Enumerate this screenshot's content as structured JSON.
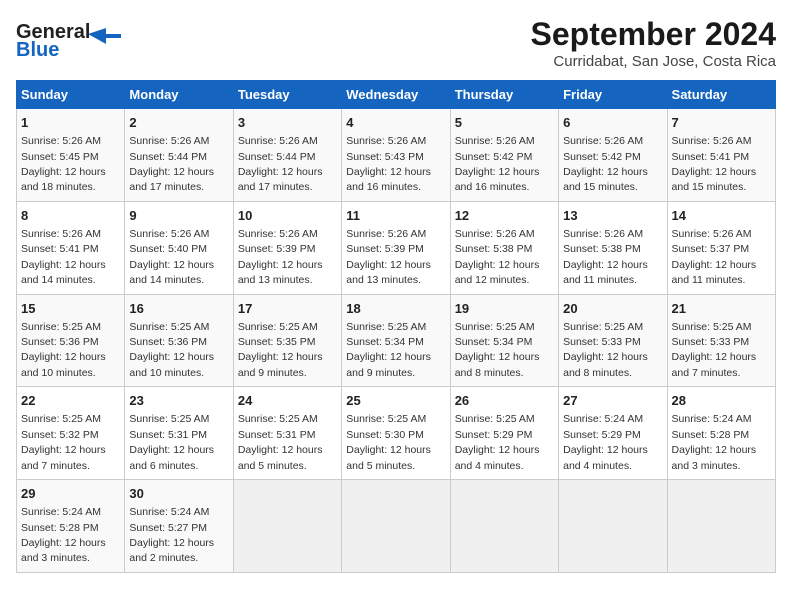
{
  "logo": {
    "line1": "General",
    "line2": "Blue"
  },
  "title": "September 2024",
  "location": "Curridabat, San Jose, Costa Rica",
  "days_of_week": [
    "Sunday",
    "Monday",
    "Tuesday",
    "Wednesday",
    "Thursday",
    "Friday",
    "Saturday"
  ],
  "weeks": [
    [
      {
        "day": 1,
        "info": "Sunrise: 5:26 AM\nSunset: 5:45 PM\nDaylight: 12 hours\nand 18 minutes."
      },
      {
        "day": 2,
        "info": "Sunrise: 5:26 AM\nSunset: 5:44 PM\nDaylight: 12 hours\nand 17 minutes."
      },
      {
        "day": 3,
        "info": "Sunrise: 5:26 AM\nSunset: 5:44 PM\nDaylight: 12 hours\nand 17 minutes."
      },
      {
        "day": 4,
        "info": "Sunrise: 5:26 AM\nSunset: 5:43 PM\nDaylight: 12 hours\nand 16 minutes."
      },
      {
        "day": 5,
        "info": "Sunrise: 5:26 AM\nSunset: 5:42 PM\nDaylight: 12 hours\nand 16 minutes."
      },
      {
        "day": 6,
        "info": "Sunrise: 5:26 AM\nSunset: 5:42 PM\nDaylight: 12 hours\nand 15 minutes."
      },
      {
        "day": 7,
        "info": "Sunrise: 5:26 AM\nSunset: 5:41 PM\nDaylight: 12 hours\nand 15 minutes."
      }
    ],
    [
      {
        "day": 8,
        "info": "Sunrise: 5:26 AM\nSunset: 5:41 PM\nDaylight: 12 hours\nand 14 minutes."
      },
      {
        "day": 9,
        "info": "Sunrise: 5:26 AM\nSunset: 5:40 PM\nDaylight: 12 hours\nand 14 minutes."
      },
      {
        "day": 10,
        "info": "Sunrise: 5:26 AM\nSunset: 5:39 PM\nDaylight: 12 hours\nand 13 minutes."
      },
      {
        "day": 11,
        "info": "Sunrise: 5:26 AM\nSunset: 5:39 PM\nDaylight: 12 hours\nand 13 minutes."
      },
      {
        "day": 12,
        "info": "Sunrise: 5:26 AM\nSunset: 5:38 PM\nDaylight: 12 hours\nand 12 minutes."
      },
      {
        "day": 13,
        "info": "Sunrise: 5:26 AM\nSunset: 5:38 PM\nDaylight: 12 hours\nand 11 minutes."
      },
      {
        "day": 14,
        "info": "Sunrise: 5:26 AM\nSunset: 5:37 PM\nDaylight: 12 hours\nand 11 minutes."
      }
    ],
    [
      {
        "day": 15,
        "info": "Sunrise: 5:25 AM\nSunset: 5:36 PM\nDaylight: 12 hours\nand 10 minutes."
      },
      {
        "day": 16,
        "info": "Sunrise: 5:25 AM\nSunset: 5:36 PM\nDaylight: 12 hours\nand 10 minutes."
      },
      {
        "day": 17,
        "info": "Sunrise: 5:25 AM\nSunset: 5:35 PM\nDaylight: 12 hours\nand 9 minutes."
      },
      {
        "day": 18,
        "info": "Sunrise: 5:25 AM\nSunset: 5:34 PM\nDaylight: 12 hours\nand 9 minutes."
      },
      {
        "day": 19,
        "info": "Sunrise: 5:25 AM\nSunset: 5:34 PM\nDaylight: 12 hours\nand 8 minutes."
      },
      {
        "day": 20,
        "info": "Sunrise: 5:25 AM\nSunset: 5:33 PM\nDaylight: 12 hours\nand 8 minutes."
      },
      {
        "day": 21,
        "info": "Sunrise: 5:25 AM\nSunset: 5:33 PM\nDaylight: 12 hours\nand 7 minutes."
      }
    ],
    [
      {
        "day": 22,
        "info": "Sunrise: 5:25 AM\nSunset: 5:32 PM\nDaylight: 12 hours\nand 7 minutes."
      },
      {
        "day": 23,
        "info": "Sunrise: 5:25 AM\nSunset: 5:31 PM\nDaylight: 12 hours\nand 6 minutes."
      },
      {
        "day": 24,
        "info": "Sunrise: 5:25 AM\nSunset: 5:31 PM\nDaylight: 12 hours\nand 5 minutes."
      },
      {
        "day": 25,
        "info": "Sunrise: 5:25 AM\nSunset: 5:30 PM\nDaylight: 12 hours\nand 5 minutes."
      },
      {
        "day": 26,
        "info": "Sunrise: 5:25 AM\nSunset: 5:29 PM\nDaylight: 12 hours\nand 4 minutes."
      },
      {
        "day": 27,
        "info": "Sunrise: 5:24 AM\nSunset: 5:29 PM\nDaylight: 12 hours\nand 4 minutes."
      },
      {
        "day": 28,
        "info": "Sunrise: 5:24 AM\nSunset: 5:28 PM\nDaylight: 12 hours\nand 3 minutes."
      }
    ],
    [
      {
        "day": 29,
        "info": "Sunrise: 5:24 AM\nSunset: 5:28 PM\nDaylight: 12 hours\nand 3 minutes."
      },
      {
        "day": 30,
        "info": "Sunrise: 5:24 AM\nSunset: 5:27 PM\nDaylight: 12 hours\nand 2 minutes."
      },
      null,
      null,
      null,
      null,
      null
    ]
  ]
}
